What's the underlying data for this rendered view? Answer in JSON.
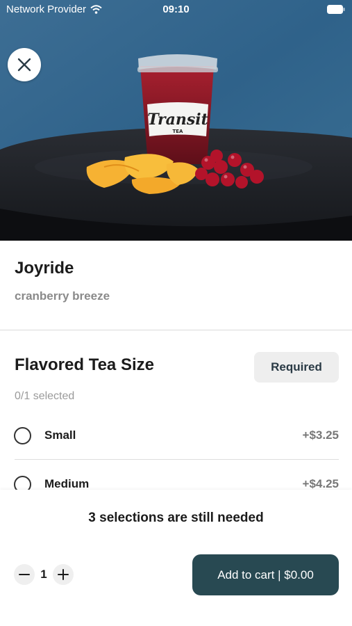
{
  "status_bar": {
    "carrier": "Network Provider",
    "time": "09:10"
  },
  "hero": {
    "cup_brand": "Transit",
    "cup_sub": "TEA",
    "close_icon": "close-icon"
  },
  "product": {
    "name": "Joyride",
    "description": "cranberry breeze"
  },
  "option_group": {
    "title": "Flavored Tea Size",
    "badge": "Required",
    "selected_count": "0/1 selected",
    "options": [
      {
        "label": "Small",
        "price": "+$3.25",
        "selected": false
      },
      {
        "label": "Medium",
        "price": "+$4.25",
        "selected": false
      }
    ]
  },
  "bottom": {
    "needed_message": "3 selections are still needed",
    "quantity": "1",
    "add_to_cart": "Add to cart | $0.00"
  },
  "colors": {
    "accent": "#284952",
    "badge_bg": "#eeeeee",
    "muted_text": "#8a8a8a"
  }
}
